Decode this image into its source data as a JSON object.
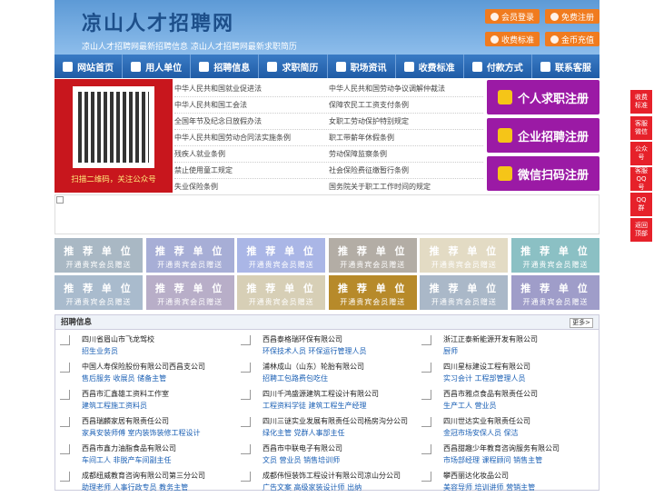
{
  "header": {
    "title": "凉山人才招聘网",
    "subtitle": "凉山人才招聘网最新招聘信息   凉山人才招聘网最新求职简历",
    "buttons": [
      "会员登录",
      "免费注册",
      "收费标准",
      "金币充值"
    ]
  },
  "nav": [
    "网站首页",
    "用人单位",
    "招聘信息",
    "求职简历",
    "职场资讯",
    "收费标准",
    "付款方式",
    "联系客服"
  ],
  "qr": {
    "caption": "扫描二维码，关注公众号"
  },
  "laws": [
    [
      "中华人民共和国就业促进法",
      "中华人民共和国劳动争议调解仲裁法"
    ],
    [
      "中华人民共和国工会法",
      "保障农民工工资支付条例"
    ],
    [
      "全国年节及纪念日放假办法",
      "女职工劳动保护特别规定"
    ],
    [
      "中华人民共和国劳动合同法实施条例",
      "职工带薪年休假条例"
    ],
    [
      "残疾人就业条例",
      "劳动保障监察条例"
    ],
    [
      "禁止使用童工规定",
      "社会保险费征缴暂行条例"
    ],
    [
      "失业保险条例",
      "国务院关于职工工作时间的规定"
    ]
  ],
  "reg": [
    "个人求职注册",
    "企业招聘注册",
    "微信扫码注册"
  ],
  "tile": {
    "a": "推 荐 单 位",
    "b": "开通贵宾会员赠送"
  },
  "tile_colors": [
    "#a9b8c4",
    "#a7aed6",
    "#aab6e6",
    "#b3ada5",
    "#e3dbc4",
    "#8bc0c4",
    "#a9bbcd",
    "#b8aec8",
    "#d7cfb6",
    "#b78a2a",
    "#aab8c8",
    "#9f9dc9"
  ],
  "list": {
    "title": "招聘信息",
    "more": "更多>",
    "items": [
      [
        "四川省眉山市飞龙驾校",
        "招生业务员"
      ],
      [
        "西昌泰格瑞环保有限公司",
        "环保技术人员 环保运行管理人员"
      ],
      [
        "浙江正泰新能源开发有限公司",
        "厨师"
      ],
      [
        "中国人寿保险股份有限公司西昌支公司",
        "售后服务 收展员 储备主管"
      ],
      [
        "浦林成山（山东）轮胎有限公司",
        "招聘工包路费包吃住"
      ],
      [
        "四川星标建设工程有限公司",
        "实习会计 工程部管理人员"
      ],
      [
        "西昌市汇鑫雄工资料工作室",
        "建筑工程施工资料员"
      ],
      [
        "四川千鸿盛源建筑工程设计有限公司",
        "工程资料学徒 建筑工程生产经理"
      ],
      [
        "西昌市雅点食品有限责任公司",
        "生产工人 营业员"
      ],
      [
        "西昌瑞麟家居有限责任公司",
        "家具安装师傅 室内装饰装修工程设计"
      ],
      [
        "四川三谜实业发展有限责任公司杨房沟分公司",
        "绿化主管 党群人事部主任"
      ],
      [
        "四川世达实业有限责任公司",
        "金冠市场安保人员 保洁"
      ],
      [
        "西昌市鑫力油脂食品有限公司",
        "车间工人 非脱产车间副主任"
      ],
      [
        "西昌市中联电子有限公司",
        "文员 营业员 销售培训师"
      ],
      [
        "西昌甜趣少年教育咨询服务有限公司",
        "市场部经理 课程顾问 销售主管"
      ],
      [
        "成都纽威教育咨询有限公司第三分公司",
        "助理老师 人事行政专员 教务主管"
      ],
      [
        "成都伟恒装饰工程设计有限公司凉山分公司",
        "广告文案 高级家装设计师 出纳"
      ],
      [
        "攀西丽达化妆品公司",
        "美容导师 培训讲师 营销主管"
      ]
    ]
  },
  "side": [
    "收费标准",
    "客服微信",
    "公众号",
    "客服QQ号",
    "QQ群",
    "返回顶部"
  ]
}
